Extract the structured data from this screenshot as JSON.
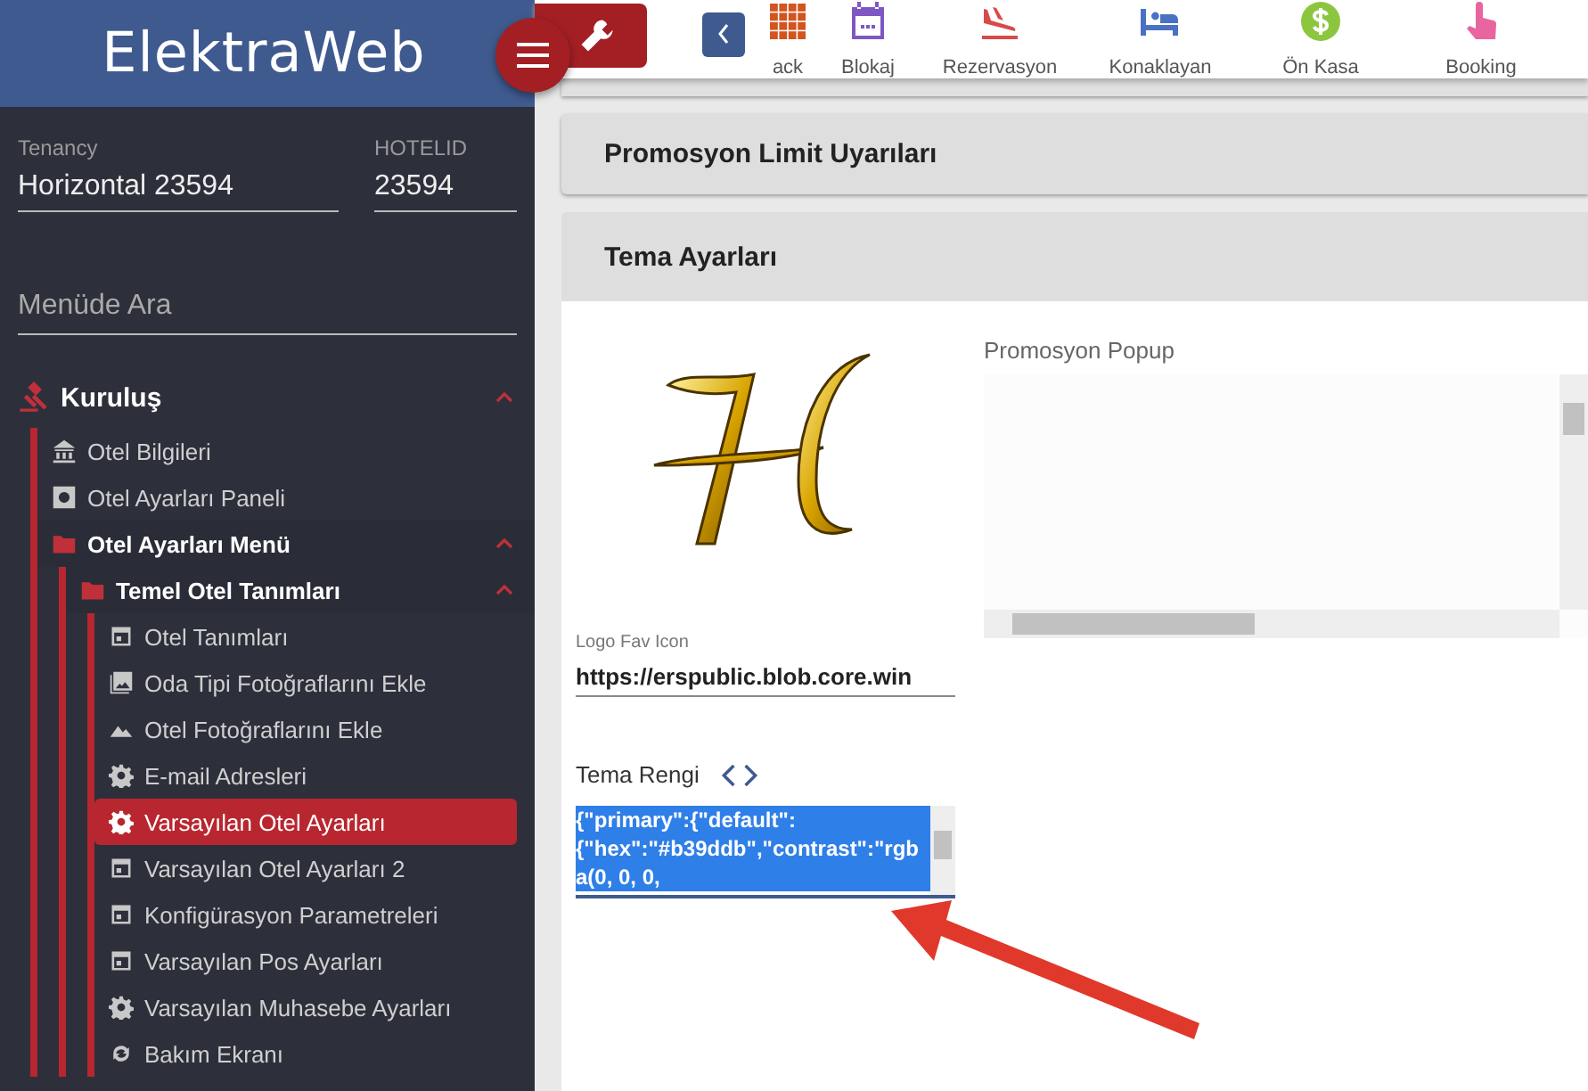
{
  "brand": "ElektraWeb",
  "tenancy": {
    "label": "Tenancy",
    "value": "Horizontal 23594"
  },
  "hotel_id": {
    "label": "HOTELID",
    "value": "23594"
  },
  "menu_search": {
    "placeholder": "Menüde Ara"
  },
  "menu": [
    {
      "label": "Kuruluş",
      "kind": "gavel",
      "expanded": true,
      "children": [
        {
          "label": "Otel Bilgileri",
          "kind": "bank"
        },
        {
          "label": "Otel Ayarları Paneli",
          "kind": "gearbox"
        },
        {
          "label": "Otel Ayarları Menü",
          "kind": "folder",
          "expanded": true,
          "children": [
            {
              "label": "Temel Otel Tanımları",
              "kind": "folder",
              "expanded": true,
              "children": [
                {
                  "label": "Otel Tanımları",
                  "kind": "calendar",
                  "selected": false
                },
                {
                  "label": "Oda Tipi Fotoğraflarını Ekle",
                  "kind": "photos",
                  "selected": false
                },
                {
                  "label": "Otel Fotoğraflarını Ekle",
                  "kind": "mountain",
                  "selected": false
                },
                {
                  "label": "E-mail Adresleri",
                  "kind": "gear",
                  "selected": false
                },
                {
                  "label": "Varsayılan Otel Ayarları",
                  "kind": "gear",
                  "selected": true
                },
                {
                  "label": "Varsayılan Otel Ayarları 2",
                  "kind": "calendar",
                  "selected": false
                },
                {
                  "label": "Konfigürasyon Parametreleri",
                  "kind": "calendar",
                  "selected": false
                },
                {
                  "label": "Varsayılan Pos Ayarları",
                  "kind": "calendar",
                  "selected": false
                },
                {
                  "label": "Varsayılan Muhasebe Ayarları",
                  "kind": "gear",
                  "selected": false
                },
                {
                  "label": "Bakım Ekranı",
                  "kind": "refresh",
                  "selected": false
                }
              ]
            }
          ]
        }
      ]
    }
  ],
  "toolbar": [
    {
      "label": "ack",
      "kind": "grid",
      "color": "#d2541f"
    },
    {
      "label": "Blokaj",
      "kind": "calendar",
      "color": "#7e57c2"
    },
    {
      "label": "Rezervasyon",
      "kind": "plane",
      "color": "#d84a4a"
    },
    {
      "label": "Konaklayan",
      "kind": "bed",
      "color": "#4a72c4"
    },
    {
      "label": "Ön Kasa",
      "kind": "dollar",
      "color": "#8cc63f"
    },
    {
      "label": "Booking",
      "kind": "hand",
      "color": "#e865a0"
    }
  ],
  "panels": [
    {
      "title": "Promosyon Limit Uyarıları"
    },
    {
      "title": "Tema Ayarları"
    }
  ],
  "popup_label": "Promosyon Popup",
  "logo_field": {
    "label": "Logo Fav Icon",
    "value": "https://erspublic.blob.core.win"
  },
  "theme_field": {
    "label": "Tema Rengi",
    "value": "{\"primary\":{\"default\":{\"hex\":\"#b39ddb\",\"contrast\":\"rgba(0, 0, 0,"
  }
}
